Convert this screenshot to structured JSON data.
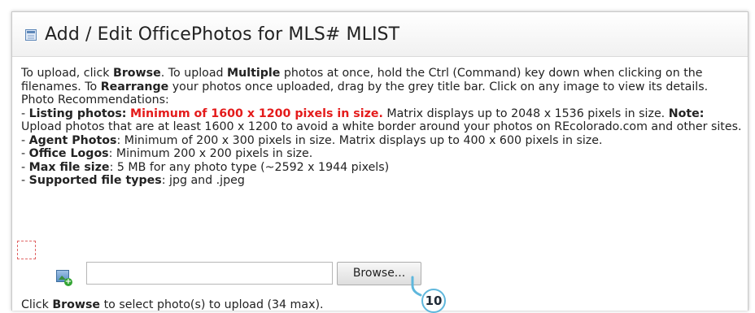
{
  "header": {
    "title": "Add / Edit OfficePhotos for MLS# MLIST"
  },
  "instructions": {
    "line1_pre": "To upload, click ",
    "browse_word": "Browse",
    "line1_mid": ". To upload ",
    "multiple_word": "Multiple",
    "line1_post": " photos at once, hold the Ctrl (Command) key down when clicking on the filenames. To ",
    "rearrange_word": "Rearrange",
    "line1_end": " your photos once uploaded, drag by the grey title bar. Click on any image to view its details.",
    "recommendations_title": "Photo Recommendations:",
    "dash": "- ",
    "listing_label": "Listing photos:",
    "listing_red": "Minimum of 1600 x 1200 pixels in size.",
    "listing_text": " Matrix displays up to 2048 x 1536 pixels in size. ",
    "note_label": "Note:",
    "note_text": " Upload photos that are at least 1600 x 1200 to avoid a white border around your photos on REcolorado.com and other sites.",
    "agent_label": "Agent Photos",
    "agent_text": ": Minimum of 200 x 300 pixels in size. Matrix displays up to 400 x 600 pixels in size.",
    "office_label": "Office Logos",
    "office_text": ": Minimum 200 x 200 pixels in size.",
    "maxsize_label": "Max file size",
    "maxsize_text": ": 5 MB for any photo type (~2592 x 1944 pixels)",
    "types_label": "Supported file types",
    "types_text": ": jpg and .jpeg"
  },
  "upload": {
    "file_value": "",
    "browse_label": "Browse..."
  },
  "footer": {
    "pre": "Click ",
    "browse_word": "Browse",
    "post": " to select photo(s) to upload (34 max)."
  },
  "callout": {
    "number": "10",
    "color": "#5fb7dc"
  },
  "colors": {
    "warning_red": "#e41b1b"
  }
}
